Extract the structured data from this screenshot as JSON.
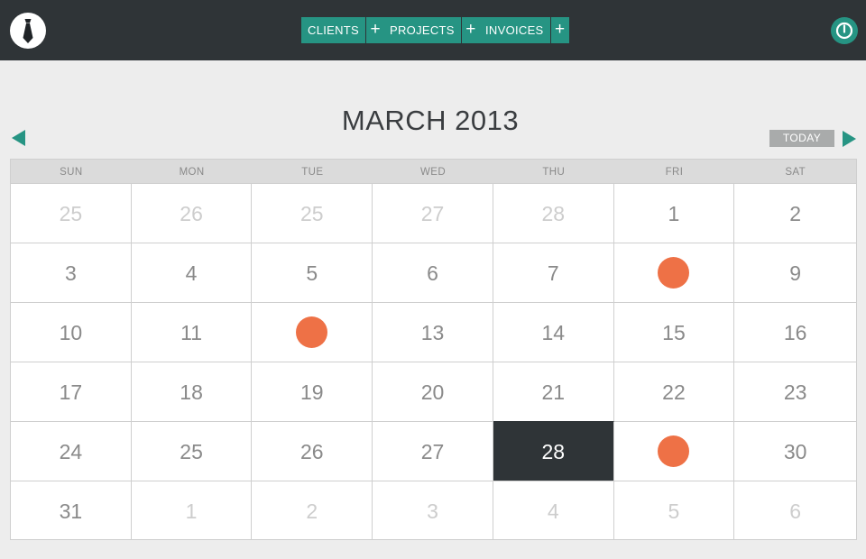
{
  "topbar": {
    "logo_icon": "necktie-icon",
    "nav": [
      {
        "label": "CLIENTS",
        "add_label": "+"
      },
      {
        "label": "PROJECTS",
        "add_label": "+"
      },
      {
        "label": "INVOICES",
        "add_label": "+"
      }
    ],
    "power_icon": "power-icon"
  },
  "calendar": {
    "title": "MARCH 2013",
    "today_label": "TODAY",
    "prev_icon": "triangle-left-icon",
    "next_icon": "triangle-right-icon",
    "weekdays": [
      "SUN",
      "MON",
      "TUE",
      "WED",
      "THU",
      "FRI",
      "SAT"
    ],
    "weeks": [
      [
        {
          "day": "25",
          "other": true
        },
        {
          "day": "26",
          "other": true
        },
        {
          "day": "25",
          "other": true
        },
        {
          "day": "27",
          "other": true
        },
        {
          "day": "28",
          "other": true
        },
        {
          "day": "1"
        },
        {
          "day": "2"
        }
      ],
      [
        {
          "day": "3"
        },
        {
          "day": "4"
        },
        {
          "day": "5"
        },
        {
          "day": "6"
        },
        {
          "day": "7"
        },
        {
          "day": "",
          "event": true
        },
        {
          "day": "9"
        }
      ],
      [
        {
          "day": "10"
        },
        {
          "day": "11"
        },
        {
          "day": "",
          "event": true
        },
        {
          "day": "13"
        },
        {
          "day": "14"
        },
        {
          "day": "15"
        },
        {
          "day": "16"
        }
      ],
      [
        {
          "day": "17"
        },
        {
          "day": "18"
        },
        {
          "day": "19"
        },
        {
          "day": "20"
        },
        {
          "day": "21"
        },
        {
          "day": "22"
        },
        {
          "day": "23"
        }
      ],
      [
        {
          "day": "24"
        },
        {
          "day": "25"
        },
        {
          "day": "26"
        },
        {
          "day": "27"
        },
        {
          "day": "28",
          "today": true
        },
        {
          "day": "",
          "event": true
        },
        {
          "day": "30"
        }
      ],
      [
        {
          "day": "31"
        },
        {
          "day": "1",
          "other": true
        },
        {
          "day": "2",
          "other": true
        },
        {
          "day": "3",
          "other": true
        },
        {
          "day": "4",
          "other": true
        },
        {
          "day": "5",
          "other": true
        },
        {
          "day": "6",
          "other": true
        }
      ]
    ]
  },
  "colors": {
    "topbar_bg": "#2f3437",
    "accent_teal": "#269483",
    "event_dot": "#ee7146",
    "today_bg": "#2f3437"
  }
}
